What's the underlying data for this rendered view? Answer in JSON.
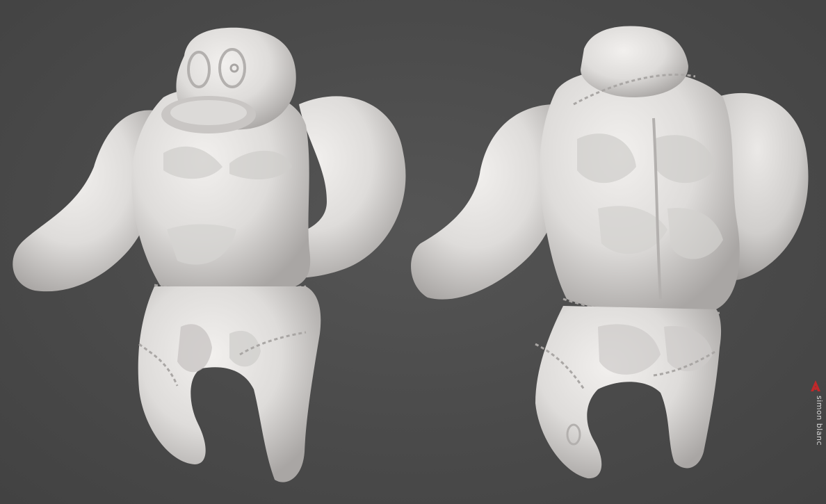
{
  "scene": {
    "description_free": true,
    "background_color": "#4b4b4b",
    "clay_color": "#e6e4e2",
    "clay_shadow": "#b9b6b4"
  },
  "watermark": {
    "text": "simon blanc",
    "logo_icon": "red-pen-logo-icon",
    "accent_color": "#c0282a"
  }
}
